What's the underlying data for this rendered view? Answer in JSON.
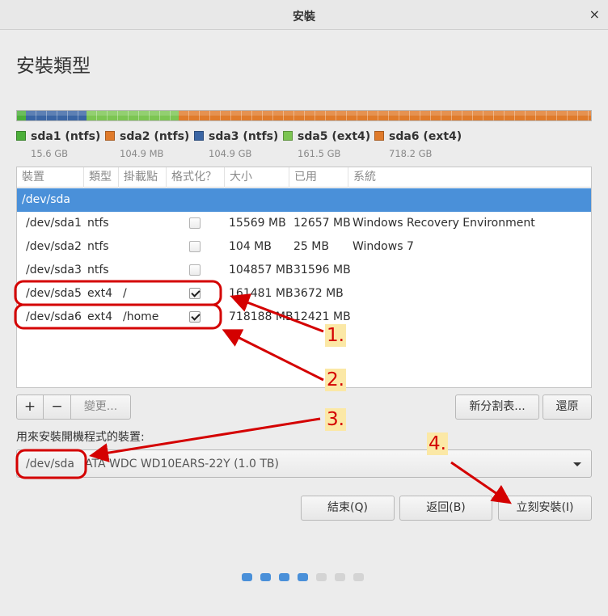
{
  "window": {
    "title": "安裝",
    "close_glyph": "×"
  },
  "page_title": "安裝類型",
  "partition_bar": {
    "segments": [
      {
        "name": "sda1",
        "color": "#4caf3a",
        "fraction": 0.0156
      },
      {
        "name": "sda2",
        "color": "#e07b2b",
        "fraction": 0.0001
      },
      {
        "name": "sda3",
        "color": "#3a65a4",
        "fraction": 0.1049
      },
      {
        "name": "sda5",
        "color": "#7cc552",
        "fraction": 0.1615
      },
      {
        "name": "sda6",
        "color": "#e07b2b",
        "fraction": 0.7182
      }
    ]
  },
  "legend": [
    {
      "name": "sda1 (ntfs)",
      "size": "15.6 GB",
      "color": "#4caf3a"
    },
    {
      "name": "sda2 (ntfs)",
      "size": "104.9 MB",
      "color": "#e07b2b"
    },
    {
      "name": "sda3 (ntfs)",
      "size": "104.9 GB",
      "color": "#3a65a4"
    },
    {
      "name": "sda5 (ext4)",
      "size": "161.5 GB",
      "color": "#7cc552"
    },
    {
      "name": "sda6 (ext4)",
      "size": "718.2 GB",
      "color": "#e07b2b"
    }
  ],
  "table": {
    "headers": [
      "裝置",
      "類型",
      "掛載點",
      "格式化？",
      "大小",
      "已用",
      "系統"
    ],
    "device_row": "/dev/sda",
    "rows": [
      {
        "device": "/dev/sda1",
        "type": "ntfs",
        "mount": "",
        "format": false,
        "size": "15569 MB",
        "used": "12657 MB",
        "system": "Windows Recovery Environment"
      },
      {
        "device": "/dev/sda2",
        "type": "ntfs",
        "mount": "",
        "format": false,
        "size": "104 MB",
        "used": "25 MB",
        "system": "Windows 7"
      },
      {
        "device": "/dev/sda3",
        "type": "ntfs",
        "mount": "",
        "format": false,
        "size": "104857 MB",
        "used": "31596 MB",
        "system": ""
      },
      {
        "device": "/dev/sda5",
        "type": "ext4",
        "mount": "/",
        "format": true,
        "size": "161481 MB",
        "used": "3672 MB",
        "system": ""
      },
      {
        "device": "/dev/sda6",
        "type": "ext4",
        "mount": "/home",
        "format": true,
        "size": "718188 MB",
        "used": "12421 MB",
        "system": ""
      }
    ]
  },
  "toolbar": {
    "add": "+",
    "remove": "−",
    "change": "變更...",
    "new_table": "新分割表...",
    "revert": "還原"
  },
  "bootloader": {
    "label": "用來安裝開機程式的裝置:",
    "device": "/dev/sda",
    "model": "ATA WDC WD10EARS-22Y (1.0 TB)"
  },
  "buttons": {
    "quit": "結束(Q)",
    "back": "返回(B)",
    "install_now": "立刻安裝(I)"
  },
  "progress": {
    "total": 7,
    "current": 4,
    "active_color": "#4a90d9",
    "inactive_color": "#d4d4d4"
  },
  "annotations": {
    "color": "#d40000",
    "labels": [
      "1.",
      "2.",
      "3.",
      "4."
    ]
  }
}
